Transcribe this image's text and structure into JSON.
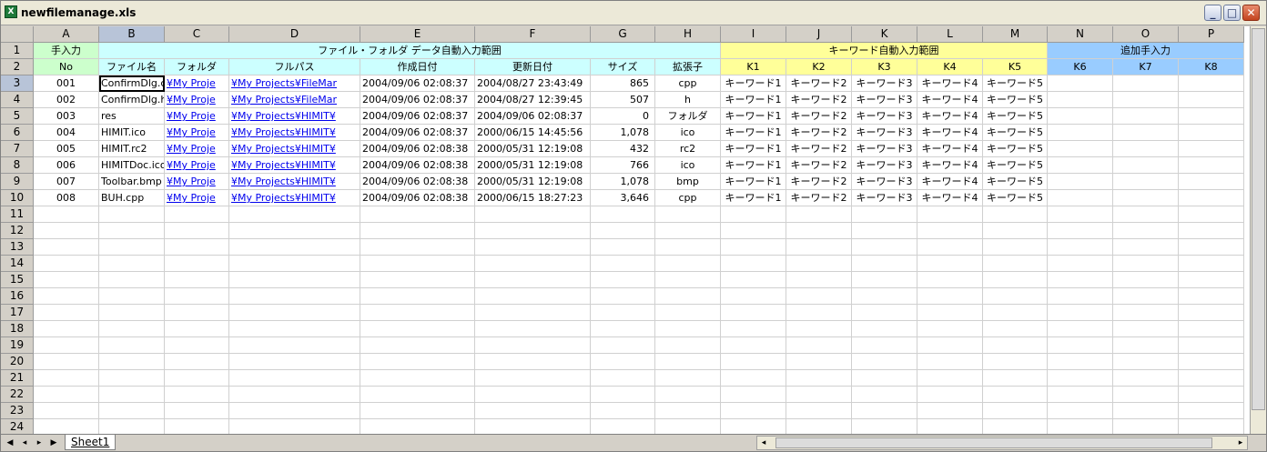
{
  "window": {
    "title": "newfilemanage.xls",
    "app_icon_text": "X",
    "minimize_glyph": "_",
    "maximize_glyph": "□",
    "close_glyph": "✕"
  },
  "columns": [
    "A",
    "B",
    "C",
    "D",
    "E",
    "F",
    "G",
    "H",
    "I",
    "J",
    "K",
    "L",
    "M",
    "N",
    "O",
    "P"
  ],
  "rows": [
    "1",
    "2",
    "3",
    "4",
    "5",
    "6",
    "7",
    "8",
    "9",
    "10",
    "11",
    "12",
    "13",
    "14",
    "15",
    "16",
    "17",
    "18",
    "19",
    "20",
    "21",
    "22",
    "23",
    "24"
  ],
  "header1": {
    "a": "手入力",
    "file_group": "ファイル・フォルダ データ自動入力範囲",
    "keyword_group": "キーワード自動入力範囲",
    "extra_group": "追加手入力"
  },
  "header2": [
    "No",
    "ファイル名",
    "フォルダ",
    "フルパス",
    "作成日付",
    "更新日付",
    "サイズ",
    "拡張子",
    "K1",
    "K2",
    "K3",
    "K4",
    "K5",
    "K6",
    "K7",
    "K8"
  ],
  "data_rows": [
    [
      "001",
      "ConfirmDlg.c",
      "¥My Proje",
      "¥My Projects¥FileMar",
      "2004/09/06 02:08:37",
      "2004/08/27 23:43:49",
      "865",
      "cpp",
      "キーワード1",
      "キーワード2",
      "キーワード3",
      "キーワード4",
      "キーワード5",
      "",
      "",
      ""
    ],
    [
      "002",
      "ConfirmDlg.h",
      "¥My Proje",
      "¥My Projects¥FileMar",
      "2004/09/06 02:08:37",
      "2004/08/27 12:39:45",
      "507",
      "h",
      "キーワード1",
      "キーワード2",
      "キーワード3",
      "キーワード4",
      "キーワード5",
      "",
      "",
      ""
    ],
    [
      "003",
      "res",
      "¥My Proje",
      "¥My Projects¥HIMIT¥",
      "2004/09/06 02:08:37",
      "2004/09/06 02:08:37",
      "0",
      "フォルダ",
      "キーワード1",
      "キーワード2",
      "キーワード3",
      "キーワード4",
      "キーワード5",
      "",
      "",
      ""
    ],
    [
      "004",
      "HIMIT.ico",
      "¥My Proje",
      "¥My Projects¥HIMIT¥",
      "2004/09/06 02:08:37",
      "2000/06/15 14:45:56",
      "1,078",
      "ico",
      "キーワード1",
      "キーワード2",
      "キーワード3",
      "キーワード4",
      "キーワード5",
      "",
      "",
      ""
    ],
    [
      "005",
      "HIMIT.rc2",
      "¥My Proje",
      "¥My Projects¥HIMIT¥",
      "2004/09/06 02:08:38",
      "2000/05/31 12:19:08",
      "432",
      "rc2",
      "キーワード1",
      "キーワード2",
      "キーワード3",
      "キーワード4",
      "キーワード5",
      "",
      "",
      ""
    ],
    [
      "006",
      "HIMITDoc.ico",
      "¥My Proje",
      "¥My Projects¥HIMIT¥",
      "2004/09/06 02:08:38",
      "2000/05/31 12:19:08",
      "766",
      "ico",
      "キーワード1",
      "キーワード2",
      "キーワード3",
      "キーワード4",
      "キーワード5",
      "",
      "",
      ""
    ],
    [
      "007",
      "Toolbar.bmp",
      "¥My Proje",
      "¥My Projects¥HIMIT¥",
      "2004/09/06 02:08:38",
      "2000/05/31 12:19:08",
      "1,078",
      "bmp",
      "キーワード1",
      "キーワード2",
      "キーワード3",
      "キーワード4",
      "キーワード5",
      "",
      "",
      ""
    ],
    [
      "008",
      "BUH.cpp",
      "¥My Proje",
      "¥My Projects¥HIMIT¥",
      "2004/09/06 02:08:38",
      "2000/06/15 18:27:23",
      "3,646",
      "cpp",
      "キーワード1",
      "キーワード2",
      "キーワード3",
      "キーワード4",
      "キーワード5",
      "",
      "",
      ""
    ]
  ],
  "sheet_tabs": [
    "Sheet1"
  ],
  "nav": {
    "first": "◀",
    "prev": "◂",
    "next": "▸",
    "last": "▶"
  },
  "colors": {
    "green": "#ccffcc",
    "cyan": "#ccffff",
    "yellow": "#ffff99",
    "blue": "#99ccff",
    "link": "#0000ee"
  }
}
